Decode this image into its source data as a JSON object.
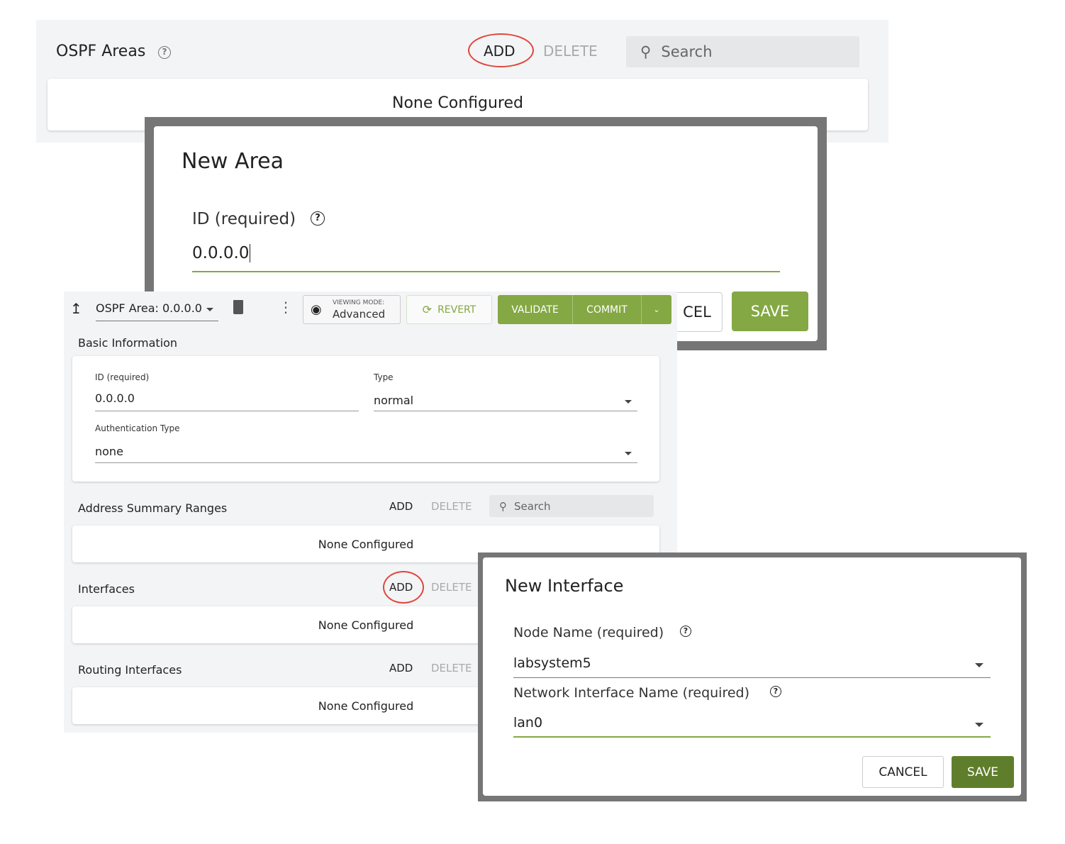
{
  "areas_panel": {
    "title": "OSPF Areas",
    "add": "ADD",
    "delete": "DELETE",
    "search_placeholder": "Search",
    "empty": "None Configured"
  },
  "new_area": {
    "title": "New Area",
    "id_label": "ID (required)",
    "id_value": "0.0.0.0",
    "cancel": "CEL",
    "save": "SAVE"
  },
  "toolbar": {
    "breadcrumb": "OSPF Area: 0.0.0.0",
    "viewing_mode_label": "VIEWING MODE:",
    "viewing_mode": "Advanced",
    "revert": "REVERT",
    "validate": "VALIDATE",
    "commit": "COMMIT"
  },
  "basic": {
    "title": "Basic Information",
    "id_label": "ID (required)",
    "id_value": "0.0.0.0",
    "type_label": "Type",
    "type_value": "normal",
    "auth_label": "Authentication Type",
    "auth_value": "none"
  },
  "sections": [
    {
      "title": "Address Summary Ranges",
      "add": "ADD",
      "delete": "DELETE",
      "search": "Search",
      "empty": "None Configured"
    },
    {
      "title": "Interfaces",
      "add": "ADD",
      "delete": "DELETE",
      "empty": "None Configured"
    },
    {
      "title": "Routing Interfaces",
      "add": "ADD",
      "delete": "DELETE",
      "empty": "None Configured"
    }
  ],
  "new_interface": {
    "title": "New Interface",
    "node_label": "Node Name (required)",
    "node_value": "labsystem5",
    "nic_label": "Network Interface Name (required)",
    "nic_value": "lan0",
    "cancel": "CANCEL",
    "save": "SAVE"
  },
  "colors": {
    "accent": "#84a843",
    "highlight": "#e0463a",
    "save_dark": "#5f7e2c"
  }
}
